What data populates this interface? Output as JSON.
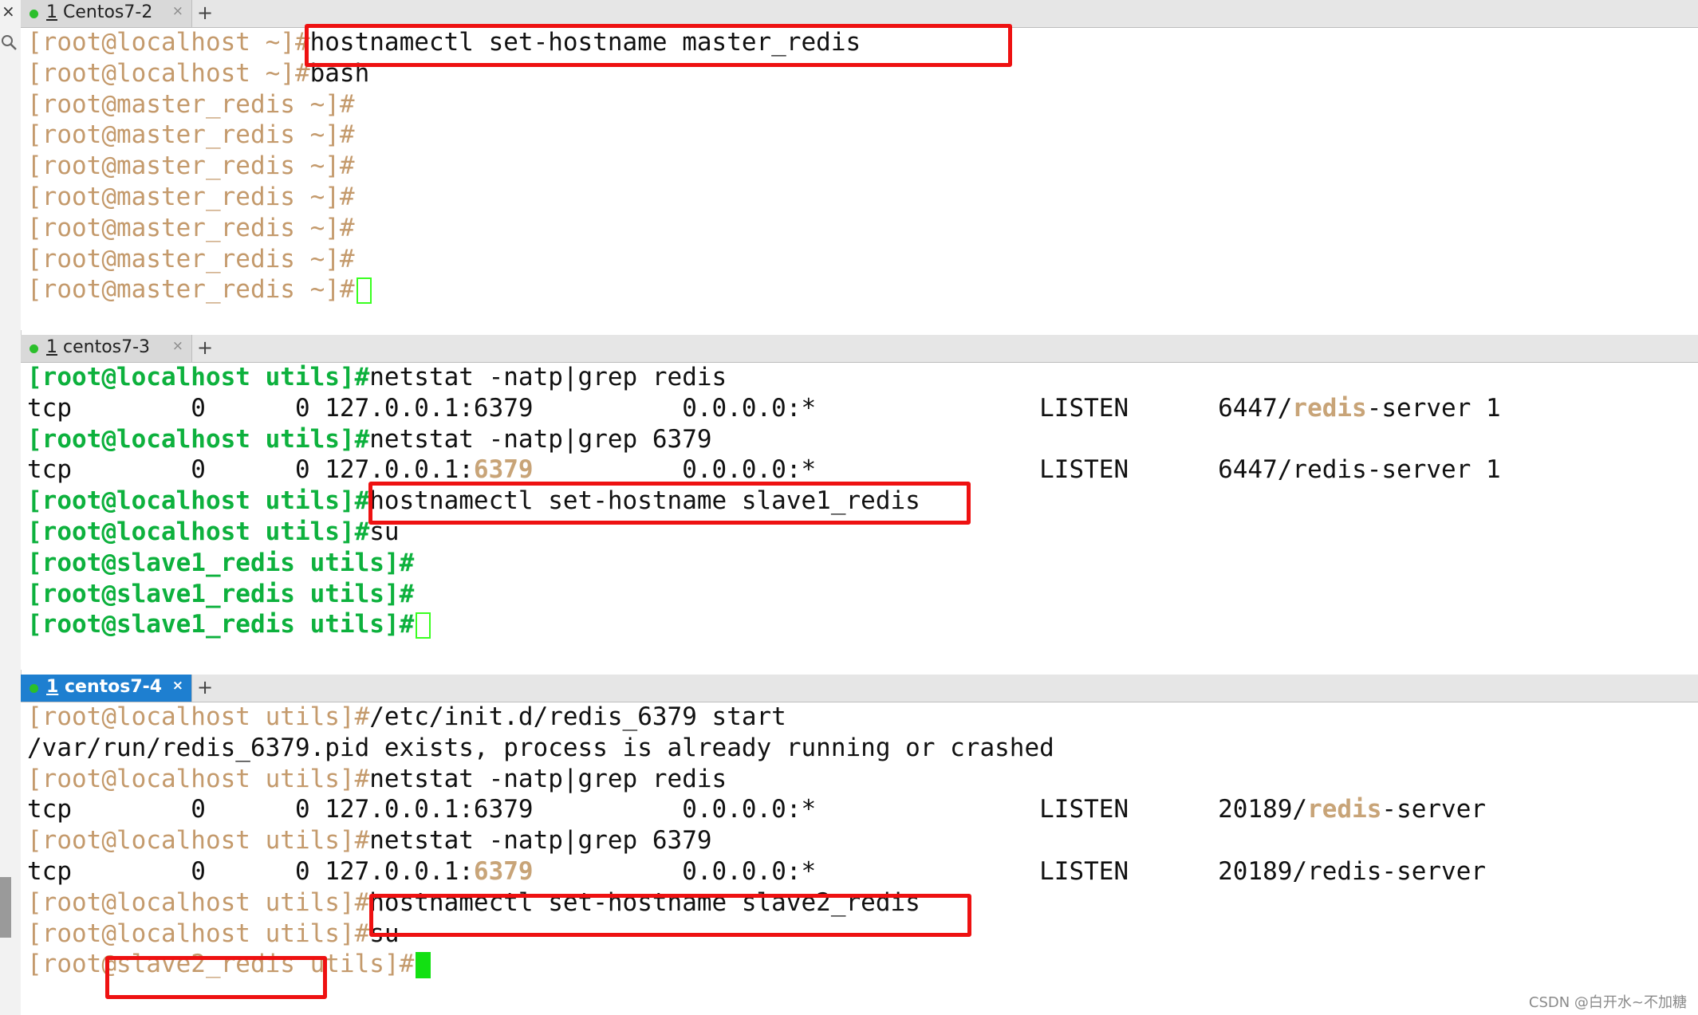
{
  "window": {
    "close_glyph": "×"
  },
  "panes": [
    {
      "tab": {
        "dot_color": "#2bbf2b",
        "number": "1",
        "name": "Centos7-2",
        "close": "×",
        "active": false
      },
      "new_tab": "+",
      "lines": [
        {
          "prompt": "[root@localhost ~]#",
          "cmd": "hostnamectl set-hostname master_redis"
        },
        {
          "prompt": "[root@localhost ~]#",
          "cmd": "bash"
        },
        {
          "prompt": "[root@master_redis ~]#",
          "cmd": ""
        },
        {
          "prompt": "[root@master_redis ~]#",
          "cmd": ""
        },
        {
          "prompt": "[root@master_redis ~]#",
          "cmd": ""
        },
        {
          "prompt": "[root@master_redis ~]#",
          "cmd": ""
        },
        {
          "prompt": "[root@master_redis ~]#",
          "cmd": ""
        },
        {
          "prompt": "[root@master_redis ~]#",
          "cmd": ""
        },
        {
          "prompt": "[root@master_redis ~]#",
          "cmd": ""
        }
      ]
    },
    {
      "tab": {
        "dot_color": "#2bbf2b",
        "number": "1",
        "name": "centos7-3",
        "close": "×",
        "active": false
      },
      "new_tab": "+",
      "lines": [
        {
          "prompt": "[root@localhost utils]#",
          "cmd": "netstat -natp|grep redis"
        },
        {
          "out_pre": "tcp        0      0 127.0.0.1:6379          0.0.0.0:*               LISTEN      6447/",
          "out_hl": "redis",
          "out_post": "-server 1"
        },
        {
          "prompt": "[root@localhost utils]#",
          "cmd": "netstat -natp|grep 6379"
        },
        {
          "out_pre": "tcp        0      0 127.0.0.1:",
          "out_hl": "6379",
          "out_post": "          0.0.0.0:*               LISTEN      6447/redis-server 1"
        },
        {
          "prompt": "[root@localhost utils]#",
          "cmd": "hostnamectl set-hostname slave1_redis"
        },
        {
          "prompt": "[root@localhost utils]#",
          "cmd": "su"
        },
        {
          "prompt": "[root@slave1_redis utils]#",
          "cmd": ""
        },
        {
          "prompt": "[root@slave1_redis utils]#",
          "cmd": ""
        },
        {
          "prompt": "[root@slave1_redis utils]#",
          "cmd": ""
        }
      ]
    },
    {
      "tab": {
        "dot_color": "#2bbf2b",
        "number": "1",
        "name": "centos7-4",
        "close": "×",
        "active": true
      },
      "new_tab": "+",
      "lines": [
        {
          "prompt": "[root@localhost utils]#",
          "cmd": "/etc/init.d/redis_6379 start"
        },
        {
          "out_pre": "/var/run/redis_6379.pid exists, process is already running or crashed",
          "out_hl": "",
          "out_post": ""
        },
        {
          "prompt": "[root@localhost utils]#",
          "cmd": "netstat -natp|grep redis"
        },
        {
          "out_pre": "tcp        0      0 127.0.0.1:6379          0.0.0.0:*               LISTEN      20189/",
          "out_hl": "redis",
          "out_post": "-server"
        },
        {
          "prompt": "[root@localhost utils]#",
          "cmd": "netstat -natp|grep 6379"
        },
        {
          "out_pre": "tcp        0      0 127.0.0.1:",
          "out_hl": "6379",
          "out_post": "          0.0.0.0:*               LISTEN      20189/redis-server"
        },
        {
          "prompt": "[root@localhost utils]#",
          "cmd": "hostnamectl set-hostname slave2_redis"
        },
        {
          "prompt": "[root@localhost utils]#",
          "cmd": "su"
        },
        {
          "prompt": "[root@slave2_redis utils]#",
          "cmd": ""
        }
      ]
    }
  ],
  "watermark": "CSDN @白开水~不加糖",
  "colors": {
    "prompt_tan": "#c49a6c",
    "prompt_green": "#0db13d",
    "highlight_box": "#ee1111",
    "cursor": "#12e012",
    "tab_active": "#1e7fd0"
  }
}
